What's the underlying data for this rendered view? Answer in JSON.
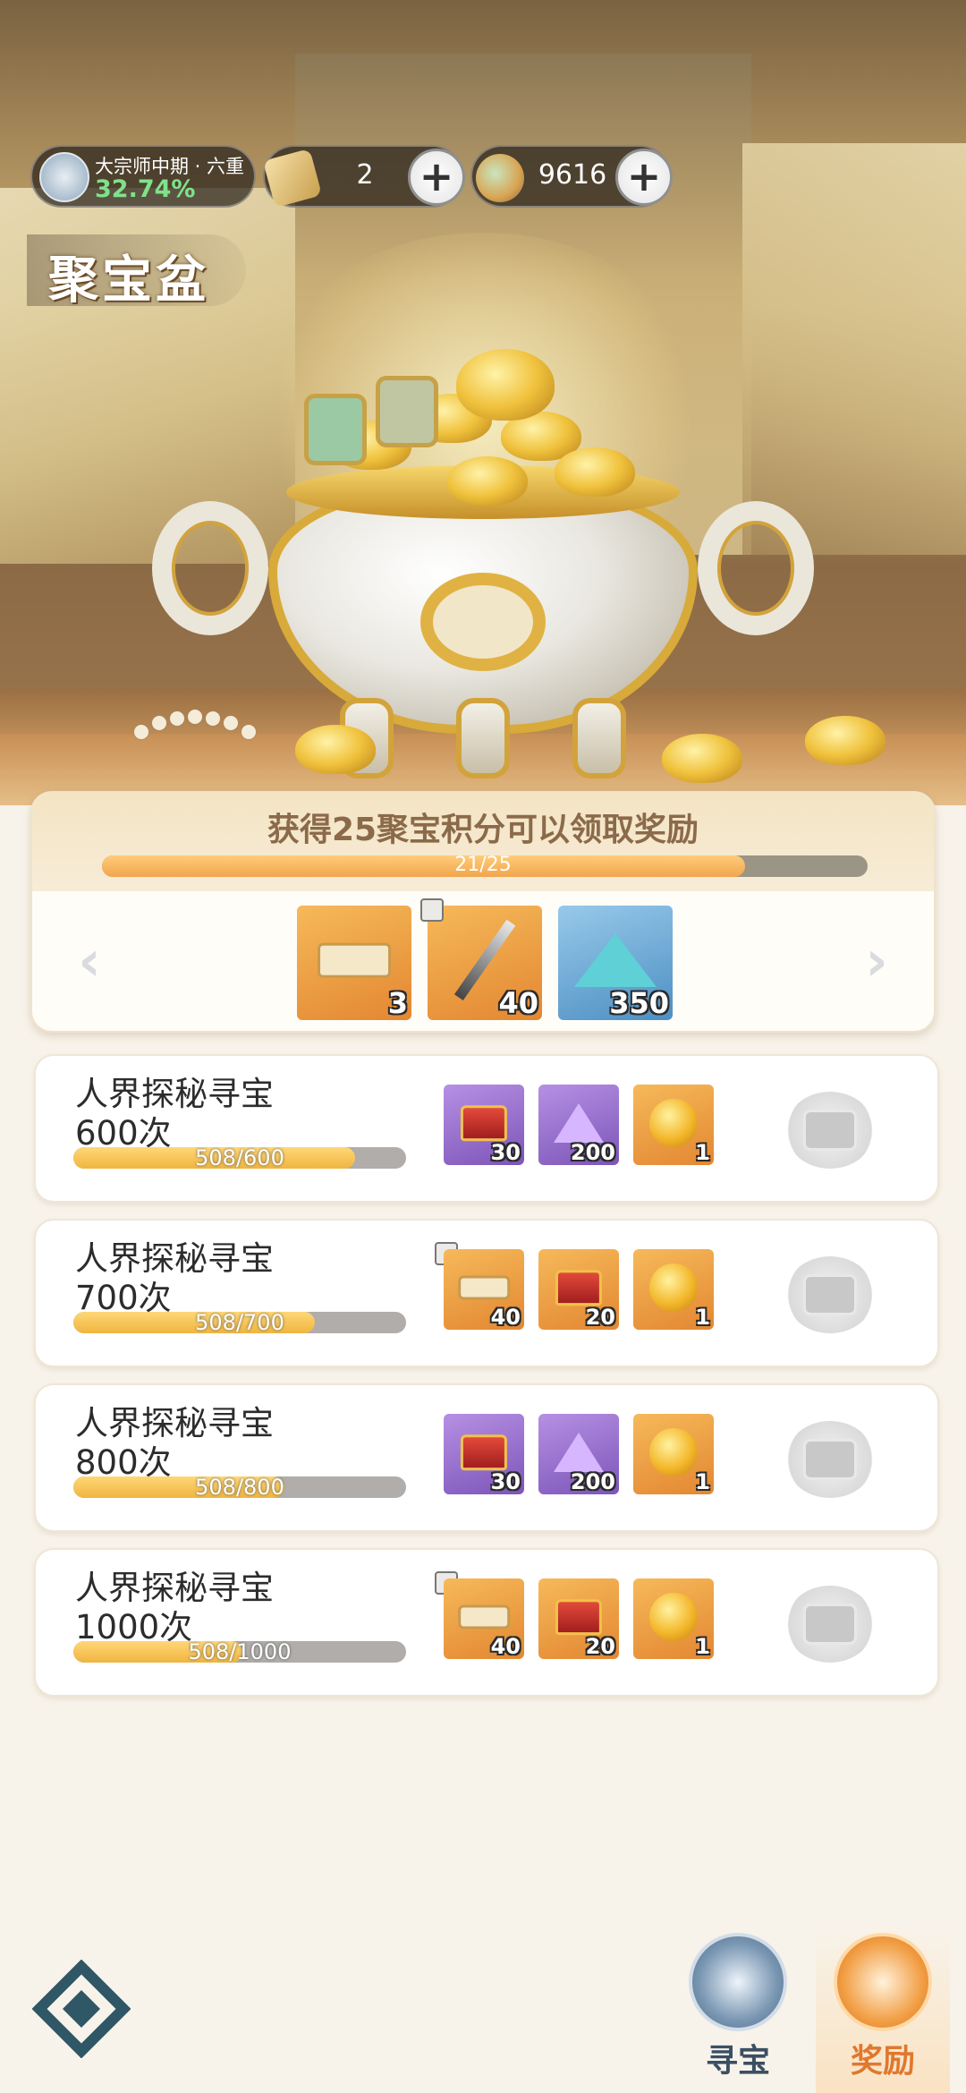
{
  "header": {
    "rank_name": "大宗师中期 · 六重",
    "rank_percent": "32.74%",
    "currency1_value": "2",
    "currency2_value": "9616",
    "plus_label": "+"
  },
  "page_title": "聚宝盆",
  "milestone": {
    "text": "获得25聚宝积分可以领取奖励",
    "progress_text": "21/25",
    "progress": 0.84,
    "prev_label": "‹",
    "next_label": "›",
    "rewards": [
      {
        "icon": "scroll-icon",
        "qty": "3"
      },
      {
        "icon": "spear-icon",
        "qty": "40"
      },
      {
        "icon": "crystal-icon",
        "qty": "350"
      }
    ]
  },
  "tasks": [
    {
      "name": "人界探秘寻宝",
      "count": "600次",
      "progress_text": "508/600",
      "progress": 0.847,
      "rewards": [
        {
          "icon": "red-chest-icon",
          "qty": "30"
        },
        {
          "icon": "purple-gem-icon",
          "qty": "200"
        },
        {
          "icon": "gold-coin-icon",
          "qty": "1"
        }
      ]
    },
    {
      "name": "人界探秘寻宝",
      "count": "700次",
      "progress_text": "508/700",
      "progress": 0.726,
      "rewards": [
        {
          "icon": "scroll-icon",
          "qty": "40"
        },
        {
          "icon": "red-chest-icon",
          "qty": "20"
        },
        {
          "icon": "gold-coin-icon",
          "qty": "1"
        }
      ]
    },
    {
      "name": "人界探秘寻宝",
      "count": "800次",
      "progress_text": "508/800",
      "progress": 0.635,
      "rewards": [
        {
          "icon": "red-chest-icon",
          "qty": "30"
        },
        {
          "icon": "purple-gem-icon",
          "qty": "200"
        },
        {
          "icon": "gold-coin-icon",
          "qty": "1"
        }
      ]
    },
    {
      "name": "人界探秘寻宝",
      "count": "1000次",
      "progress_text": "508/1000",
      "progress": 0.508,
      "rewards": [
        {
          "icon": "scroll-icon",
          "qty": "40"
        },
        {
          "icon": "red-chest-icon",
          "qty": "20"
        },
        {
          "icon": "gold-coin-icon",
          "qty": "1"
        }
      ]
    }
  ],
  "nav": {
    "seek_label": "寻宝",
    "reward_label": "奖励",
    "active": "reward"
  }
}
